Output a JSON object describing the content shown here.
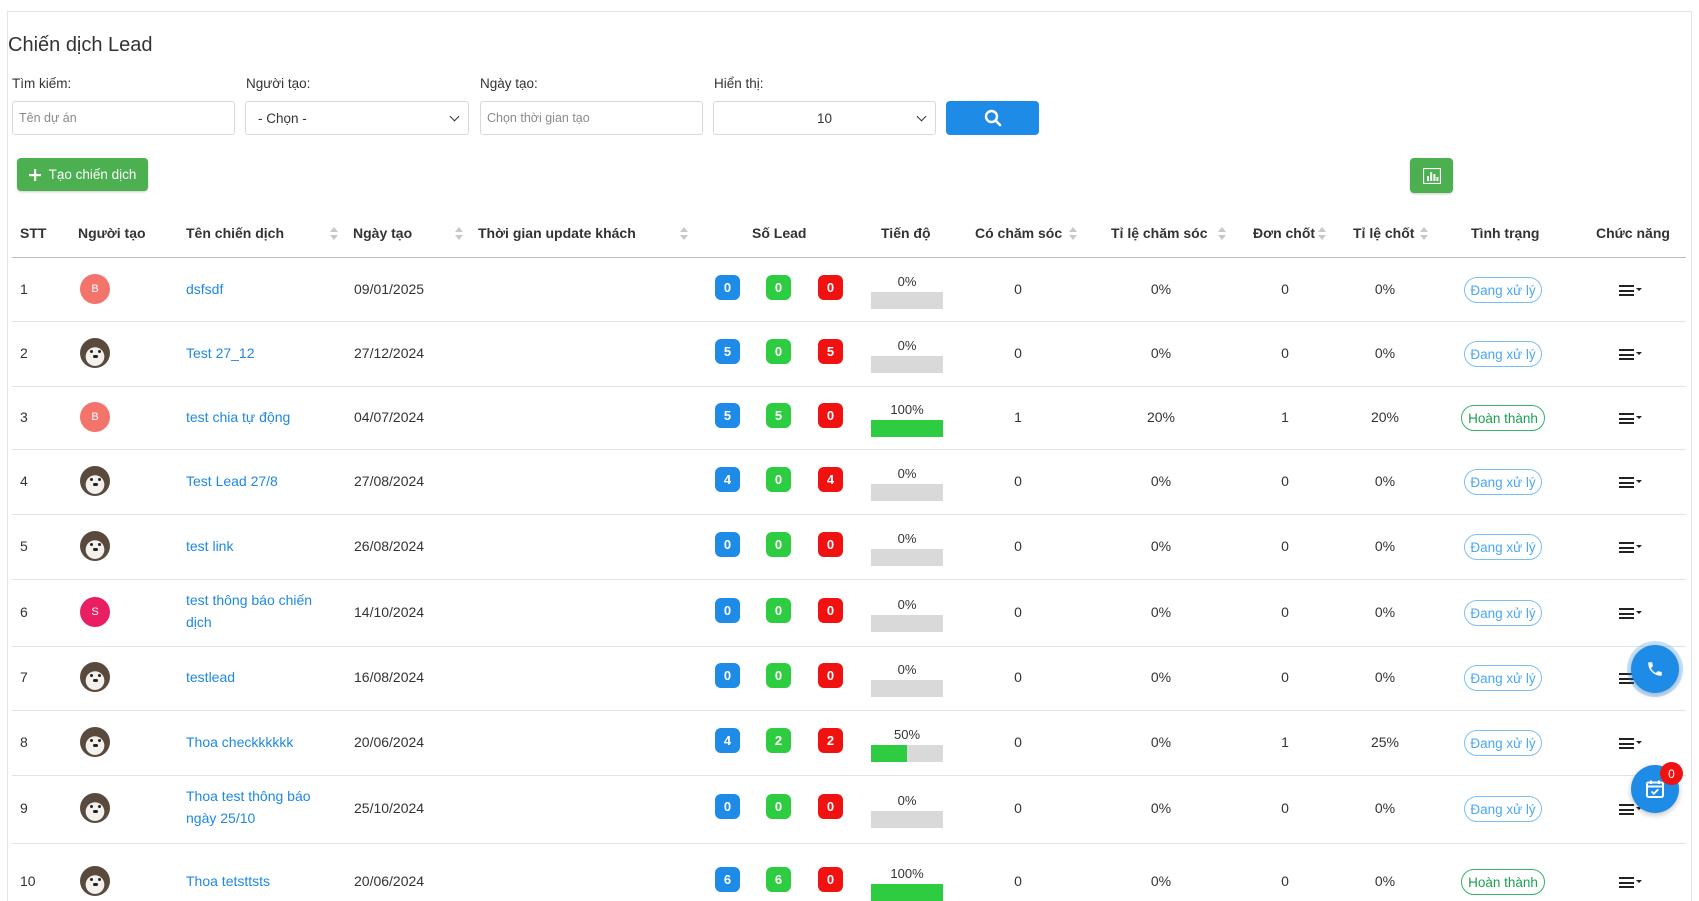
{
  "page_title": "Chiến dịch Lead",
  "filters": {
    "search_label": "Tìm kiếm:",
    "search_placeholder": "Tên dự án",
    "creator_label": "Người tạo:",
    "creator_value": "- Chọn -",
    "date_label": "Ngày tạo:",
    "date_placeholder": "Chọn thời gian tạo",
    "display_label": "Hiển thị:",
    "display_value": "10"
  },
  "create_button_label": "Tạo chiến dịch",
  "table": {
    "headers": {
      "stt": "STT",
      "creator": "Người tạo",
      "campaign": "Tên chiến dịch",
      "date": "Ngày tạo",
      "update_time": "Thời gian update khách",
      "leads": "Số Lead",
      "progress": "Tiến độ",
      "cared": "Có chăm sóc",
      "care_rate": "Tỉ lệ chăm sóc",
      "orders": "Đơn chốt",
      "close_rate": "Tỉ lệ chốt",
      "status": "Tình trạng",
      "actions": "Chức năng"
    },
    "rows": [
      {
        "stt": "1",
        "avatar": "B",
        "avatar_color": "#f4736b",
        "name_lines": [
          "dsfsdf"
        ],
        "date": "09/01/2025",
        "leads": [
          "0",
          "0",
          "0"
        ],
        "progress": "0%",
        "progress_value": 0,
        "cared": "0",
        "care_rate": "0%",
        "orders": "0",
        "close_rate": "0%",
        "status": "Đang xử lý",
        "status_type": "processing"
      },
      {
        "stt": "2",
        "avatar": "",
        "avatar_color": "dog",
        "name_lines": [
          "Test 27_12"
        ],
        "date": "27/12/2024",
        "leads": [
          "5",
          "0",
          "5"
        ],
        "progress": "0%",
        "progress_value": 0,
        "cared": "0",
        "care_rate": "0%",
        "orders": "0",
        "close_rate": "0%",
        "status": "Đang xử lý",
        "status_type": "processing"
      },
      {
        "stt": "3",
        "avatar": "B",
        "avatar_color": "#f4736b",
        "name_lines": [
          "test chia tự động"
        ],
        "date": "04/07/2024",
        "leads": [
          "5",
          "5",
          "0"
        ],
        "progress": "100%",
        "progress_value": 100,
        "cared": "1",
        "care_rate": "20%",
        "orders": "1",
        "close_rate": "20%",
        "status": "Hoàn thành",
        "status_type": "done"
      },
      {
        "stt": "4",
        "avatar": "",
        "avatar_color": "dog",
        "name_lines": [
          "Test Lead 27/8"
        ],
        "date": "27/08/2024",
        "leads": [
          "4",
          "0",
          "4"
        ],
        "progress": "0%",
        "progress_value": 0,
        "cared": "0",
        "care_rate": "0%",
        "orders": "0",
        "close_rate": "0%",
        "status": "Đang xử lý",
        "status_type": "processing"
      },
      {
        "stt": "5",
        "avatar": "",
        "avatar_color": "dog",
        "name_lines": [
          "test link"
        ],
        "date": "26/08/2024",
        "leads": [
          "0",
          "0",
          "0"
        ],
        "progress": "0%",
        "progress_value": 0,
        "cared": "0",
        "care_rate": "0%",
        "orders": "0",
        "close_rate": "0%",
        "status": "Đang xử lý",
        "status_type": "processing"
      },
      {
        "stt": "6",
        "avatar": "S",
        "avatar_color": "#e91e63",
        "name_lines": [
          "test thông báo chiến",
          "dịch"
        ],
        "date": "14/10/2024",
        "leads": [
          "0",
          "0",
          "0"
        ],
        "progress": "0%",
        "progress_value": 0,
        "cared": "0",
        "care_rate": "0%",
        "orders": "0",
        "close_rate": "0%",
        "status": "Đang xử lý",
        "status_type": "processing"
      },
      {
        "stt": "7",
        "avatar": "",
        "avatar_color": "dog",
        "name_lines": [
          "testlead"
        ],
        "date": "16/08/2024",
        "leads": [
          "0",
          "0",
          "0"
        ],
        "progress": "0%",
        "progress_value": 0,
        "cared": "0",
        "care_rate": "0%",
        "orders": "0",
        "close_rate": "0%",
        "status": "Đang xử lý",
        "status_type": "processing"
      },
      {
        "stt": "8",
        "avatar": "",
        "avatar_color": "dog",
        "name_lines": [
          "Thoa checkkkkkk"
        ],
        "date": "20/06/2024",
        "leads": [
          "4",
          "2",
          "2"
        ],
        "progress": "50%",
        "progress_value": 50,
        "cared": "0",
        "care_rate": "0%",
        "orders": "1",
        "close_rate": "25%",
        "status": "Đang xử lý",
        "status_type": "processing"
      },
      {
        "stt": "9",
        "avatar": "",
        "avatar_color": "dog",
        "name_lines": [
          "Thoa test thông báo",
          "ngày 25/10"
        ],
        "date": "25/10/2024",
        "leads": [
          "0",
          "0",
          "0"
        ],
        "progress": "0%",
        "progress_value": 0,
        "cared": "0",
        "care_rate": "0%",
        "orders": "0",
        "close_rate": "0%",
        "status": "Đang xử lý",
        "status_type": "processing"
      },
      {
        "stt": "10",
        "avatar": "",
        "avatar_color": "dog",
        "name_lines": [
          "Thoa tetsttsts"
        ],
        "date": "20/06/2024",
        "leads": [
          "6",
          "6",
          "0"
        ],
        "progress": "100%",
        "progress_value": 100,
        "cared": "0",
        "care_rate": "0%",
        "orders": "0",
        "close_rate": "0%",
        "status": "Hoàn thành",
        "status_type": "done"
      }
    ]
  },
  "notification_count": "0",
  "icons": {
    "search": "search-icon",
    "create": "plus-icon",
    "chart": "bar-chart-icon",
    "menu": "menu-dropdown-icon",
    "phone": "phone-icon",
    "calendar": "calendar-check-icon"
  },
  "colors": {
    "primary": "#1e8be6",
    "success": "#4caf50",
    "lead_blue": "#1e8be6",
    "lead_green": "#2ecc40",
    "lead_red": "#f01111",
    "link": "#1e88e5"
  }
}
